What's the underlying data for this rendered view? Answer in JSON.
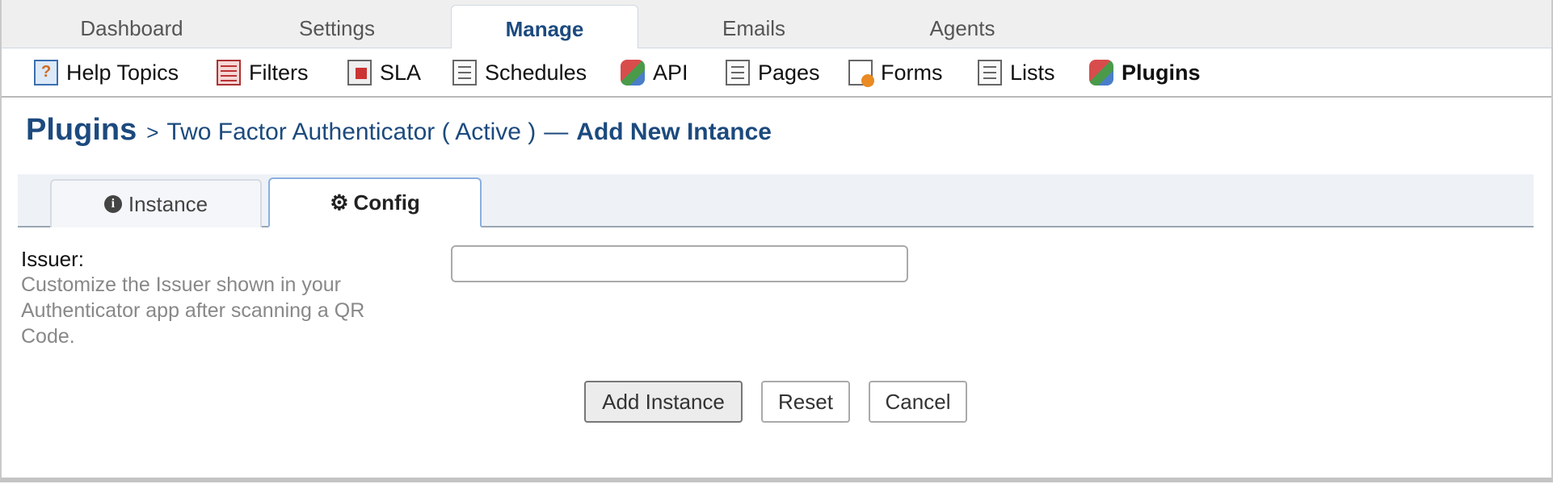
{
  "top_nav": {
    "tabs": [
      {
        "label": "Dashboard"
      },
      {
        "label": "Settings"
      },
      {
        "label": "Manage"
      },
      {
        "label": "Emails"
      },
      {
        "label": "Agents"
      }
    ],
    "active_tab": "Manage"
  },
  "sub_nav": {
    "items": [
      {
        "label": "Help Topics",
        "icon": "help-topics-icon"
      },
      {
        "label": "Filters",
        "icon": "filters-icon"
      },
      {
        "label": "SLA",
        "icon": "sla-icon"
      },
      {
        "label": "Schedules",
        "icon": "schedules-icon"
      },
      {
        "label": "API",
        "icon": "api-icon"
      },
      {
        "label": "Pages",
        "icon": "pages-icon"
      },
      {
        "label": "Forms",
        "icon": "forms-icon"
      },
      {
        "label": "Lists",
        "icon": "lists-icon"
      },
      {
        "label": "Plugins",
        "icon": "plugins-icon"
      }
    ],
    "current": "Plugins"
  },
  "heading": {
    "title": "Plugins",
    "separator": ">",
    "plugin_name": "Two Factor Authenticator ( Active )",
    "dash": "—",
    "action": "Add New Intance"
  },
  "form_tabs": {
    "instance_label": "Instance",
    "config_label": "Config",
    "active": "Config"
  },
  "config_form": {
    "issuer_label": "Issuer:",
    "issuer_hint": "Customize the Issuer shown in your Authenticator app after scanning a QR Code.",
    "issuer_value": "",
    "issuer_placeholder": ""
  },
  "actions": {
    "add_label": "Add Instance",
    "reset_label": "Reset",
    "cancel_label": "Cancel"
  },
  "colors": {
    "accent": "#1c4a7e",
    "hint_text": "#888888",
    "tab_bar_bg": "#eef2f7"
  }
}
